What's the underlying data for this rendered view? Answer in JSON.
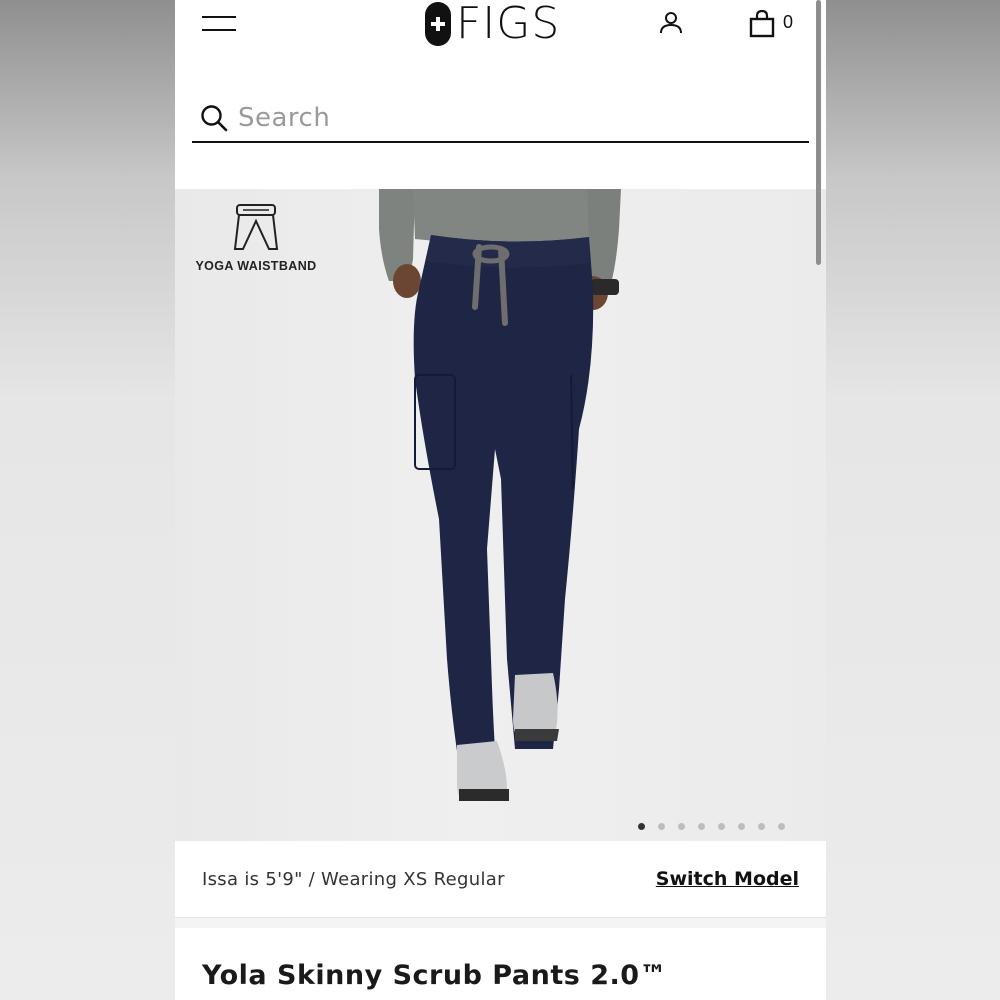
{
  "header": {
    "logo_text": "FIGS",
    "cart_count": "0"
  },
  "search": {
    "placeholder": "Search"
  },
  "product_image": {
    "badge_label": "YOGA WAISTBAND",
    "carousel": {
      "total": 8,
      "active": 1
    }
  },
  "model_info": {
    "text": "Issa is 5'9\" / Wearing XS Regular",
    "switch_label": "Switch Model"
  },
  "product": {
    "title": "Yola Skinny Scrub Pants 2.0™"
  },
  "colors": {
    "pants": "#1f2545",
    "shirt": "#7d817d",
    "text": "#111111"
  },
  "icons": [
    "menu-icon",
    "account-icon",
    "cart-icon",
    "search-icon",
    "waistband-icon"
  ]
}
